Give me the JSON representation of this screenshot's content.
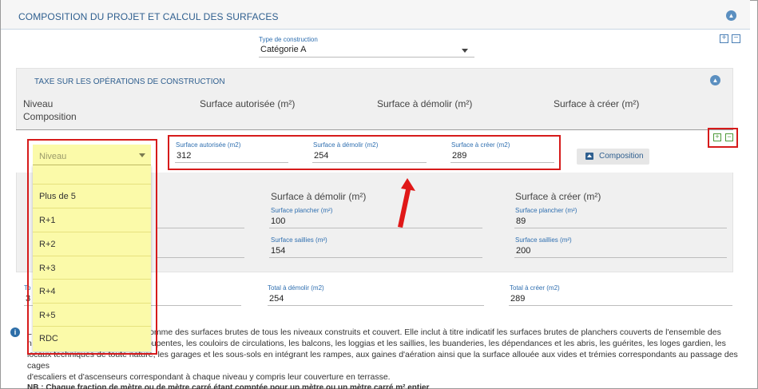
{
  "section": {
    "title": "COMPOSITION DU PROJET ET CALCUL DES SURFACES"
  },
  "construction": {
    "label": "Type de construction",
    "value": "Catégorie A"
  },
  "tax": {
    "title": "TAXE SUR LES OPÉRATIONS DE CONSTRUCTION",
    "columns": {
      "niveau": "Niveau",
      "composition": "Composition",
      "autorisee": "Surface autorisée (m²)",
      "demolir": "Surface à démolir (m²)",
      "creer": "Surface à créer (m²)"
    }
  },
  "row": {
    "niveau_placeholder": "Niveau",
    "autorisee": {
      "label": "Surface autorisée (m2)",
      "value": "312"
    },
    "demolir": {
      "label": "Surface à démolir (m2)",
      "value": "254"
    },
    "creer": {
      "label": "Surface à créer (m2)",
      "value": "289"
    },
    "composition_button": "Composition"
  },
  "details": {
    "demolir": {
      "heading": "Surface à démolir (m²)",
      "plancher_label": "Surface plancher (m²)",
      "plancher_value": "100",
      "saillies_label": "Surface saillies (m²)",
      "saillies_value": "154"
    },
    "creer": {
      "heading": "Surface à créer (m²)",
      "plancher_label": "Surface plancher (m²)",
      "plancher_value": "89",
      "saillies_label": "Surface saillies (m²)",
      "saillies_value": "200"
    }
  },
  "totals": {
    "autorisee_partial_label": "To",
    "autorisee_partial_value": "3",
    "demolir_label": "Total à démolir (m2)",
    "demolir_value": "254",
    "creer_label": "Total à créer (m2)",
    "creer_value": "289"
  },
  "dropdown": {
    "options": [
      "Plus de 5",
      "R+1",
      "R+2",
      "R+3",
      "R+4",
      "R+5",
      "RDC"
    ]
  },
  "info": {
    "line1": "L                                          à la somme des surfaces brutes de tous les niveaux construits et couvert. Elle inclut à titre indicatif les surfaces brutes de planchers couverts de l'ensemble des",
    "line2": "n                                          les soupentes, les couloirs de circulations, les balcons, les loggias et les saillies, les buanderies, les dépendances et les abris, les guérites, les loges gardien, les",
    "line3": "locaux techniques de toute nature, les garages et les sous-sols en intégrant les rampes, aux gaines d'aération ainsi que la surface allouée aux vides et trémies correspondants au passage des cages",
    "line4": "d'escaliers et d'ascenseurs correspondant à chaque niveau y compris leur couverture en terrasse.",
    "nb": "NB : Chaque fraction de mètre ou de mètre carré étant comptée pour un mètre ou un mètre carré m² entier"
  }
}
